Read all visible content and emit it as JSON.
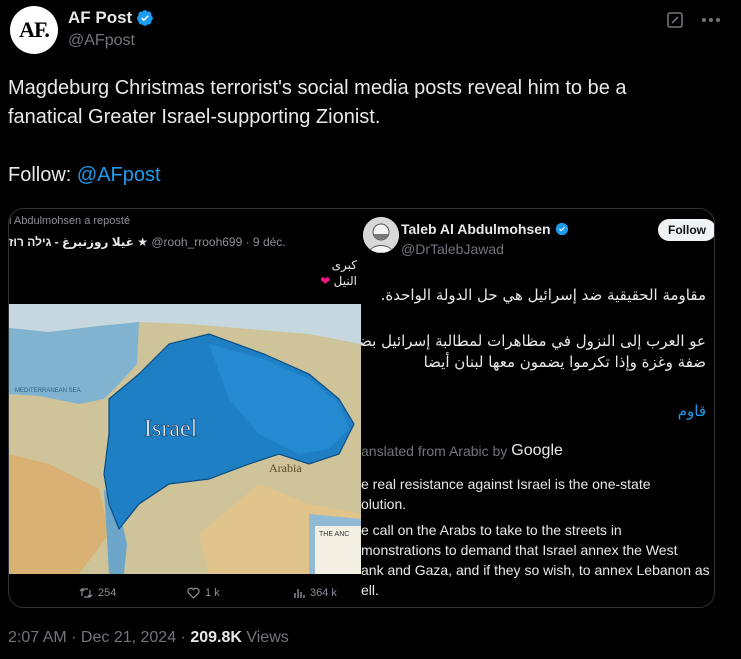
{
  "author": {
    "avatar_text": "AF.",
    "name": "AF Post",
    "handle": "@AFpost"
  },
  "tweet": {
    "line1": "Magdeburg Christmas terrorist's social media posts reveal him to be a",
    "line2": "fanatical Greater Israel-supporting Zionist.",
    "follow_label": "Follow: ",
    "follow_mention": "@AFpost"
  },
  "embedded_left": {
    "repost_line": "l Abdulmohsen a reposté",
    "user_name": "غيلا روزنبرغ - גילה רוז",
    "user_meta": "@rooh_rrooh699 · 9 déc.",
    "arabic_line1": "كبرى",
    "arabic_line2": "النيل",
    "map_label_israel": "Israel",
    "map_label_arabia": "Arabia",
    "map_label_sea": "MEDITERRANEAN SEA",
    "map_label_corner": "THE ANC",
    "actions": {
      "retweets": "254",
      "likes": "1 k",
      "views": "364 k"
    }
  },
  "embedded_right": {
    "name": "Taleb Al Abdulmohsen",
    "handle": "@DrTalebJawad",
    "follow_label": "Follow",
    "arabic_p1": "مقاومة الحقيقية ضد إسرائيل هي حل الدولة الواحدة.",
    "arabic_p2_l1": "عو العرب إلى النزول في مظاهرات لمطالبة إسرائيل بضم",
    "arabic_p2_l2": "ضفة وغزة وإذا تكرموا يضمون معها لبنان أيضا",
    "arabic_link": "قاوم",
    "translated_label": "anslated from Arabic by",
    "translated_brand": "Google",
    "trans_p1_l1": "e real resistance against Israel is the one-state",
    "trans_p1_l2": "olution.",
    "trans_p2_l1": "e call on the Arabs to take to the streets in",
    "trans_p2_l2": "monstrations to demand that Israel annex the West",
    "trans_p2_l3": "ank and Gaza, and if they so wish, to annex Lebanon as",
    "trans_p2_l4": "ell."
  },
  "footer": {
    "time": "2:07 AM · Dec 21, 2024 · ",
    "views_count": "209.8K",
    "views_label": " Views"
  },
  "colors": {
    "background": "#000000",
    "text": "#e7e9ea",
    "muted": "#71767b",
    "link": "#1d9bf0",
    "verified": "#1d9bf0",
    "map_blue": "#1f7fc4"
  },
  "icons": [
    "verified-badge-icon",
    "edit-icon",
    "more-icon",
    "retweet-icon",
    "like-icon",
    "views-icon"
  ]
}
